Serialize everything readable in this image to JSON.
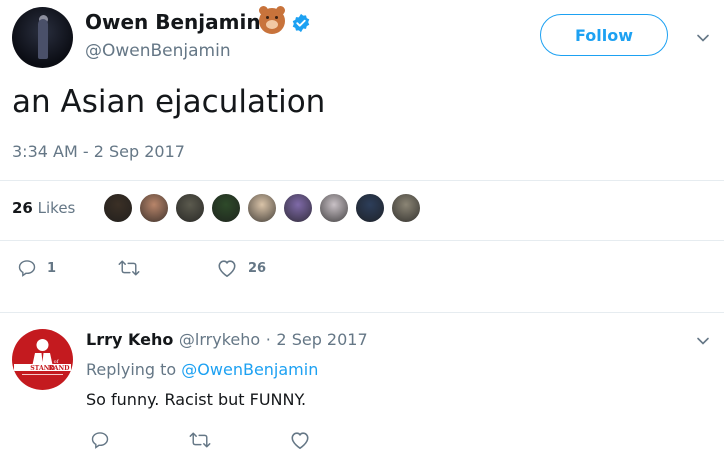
{
  "tweet": {
    "author_name": "Owen Benjamin",
    "author_handle": "@OwenBenjamin",
    "follow_label": "Follow",
    "text": "an Asian ejaculation",
    "timestamp": "3:34 AM - 2 Sep 2017",
    "likes_count": "26",
    "likes_label": "Likes",
    "reply_count": "1",
    "like_action_count": "26",
    "liker_avatar_colors": [
      "#3b3026",
      "#b8856a",
      "#5b5a4e",
      "#2e4a2a",
      "#d9c3a8",
      "#7f6aa8",
      "#c9c1c6",
      "#2d3e5a",
      "#8b8575"
    ]
  },
  "reply": {
    "author_name": "Lrry Keho",
    "author_handle": "@lrrykeho",
    "date": "2 Sep 2017",
    "meta_separator": "·",
    "replying_prefix": "Replying to",
    "replying_to": "@OwenBenjamin",
    "text": "So funny. Racist but FUNNY.",
    "avatar_text_top": "STAND",
    "avatar_text_mid": "of",
    "avatar_text_bottom": "RAND"
  },
  "colors": {
    "accent": "#1da1f2",
    "secondary_text": "#657786",
    "divider": "#e6ecf0",
    "reply_avatar_bg": "#c41a1f"
  }
}
